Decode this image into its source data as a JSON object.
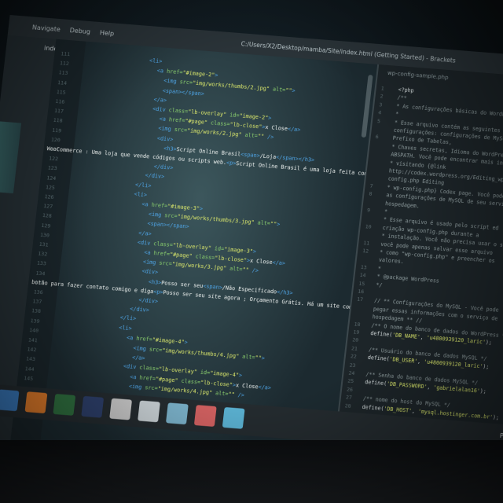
{
  "menubar": {
    "items": [
      "Navigate",
      "Debug",
      "Help"
    ],
    "window_title": "C:/Users/X2/Desktop/mamba/Site/index.html (Getting Started) - Brackets"
  },
  "sidebar": {
    "active_file": "index.html"
  },
  "editor": {
    "line_numbers": [
      "111",
      "112",
      "113",
      "114",
      "115",
      "116",
      "117",
      "118",
      "119",
      "120",
      "121",
      "122",
      "123",
      "124",
      "125",
      "126",
      "127",
      "128",
      "129",
      "130",
      "131",
      "132",
      "133",
      "134",
      "135",
      "136",
      "137",
      "138",
      "139",
      "140",
      "141",
      "142",
      "143",
      "144",
      "145"
    ],
    "lines": [
      {
        "indent": 110,
        "html": "<span class='tag'>&lt;li&gt;</span>"
      },
      {
        "indent": 126,
        "html": "<span class='tag'>&lt;a</span> <span class='attr'>href=</span><span class='str'>\"#image-2\"</span><span class='tag'>&gt;</span>"
      },
      {
        "indent": 140,
        "html": "<span class='tag'>&lt;img</span> <span class='attr'>src=</span><span class='str'>\"img/works/thumbs/2.jpg\"</span> <span class='attr'>alt=</span><span class='str'>\"\"</span><span class='tag'>&gt;</span>"
      },
      {
        "indent": 140,
        "html": "<span class='tag'>&lt;span&gt;&lt;/span&gt;</span>"
      },
      {
        "indent": 126,
        "html": "<span class='tag'>&lt;/a&gt;</span>"
      },
      {
        "indent": 126,
        "html": "<span class='tag'>&lt;div</span> <span class='attr'>class=</span><span class='str'>\"lb-overlay\"</span> <span class='attr'>id=</span><span class='str'>\"image-2\"</span><span class='tag'>&gt;</span>"
      },
      {
        "indent": 140,
        "html": "<span class='tag'>&lt;a</span> <span class='attr'>href=</span><span class='str'>\"#page\"</span> <span class='attr'>class=</span><span class='str'>\"lb-close\"</span><span class='tag'>&gt;</span><span class='txt'>x Close</span><span class='tag'>&lt;/a&gt;</span>"
      },
      {
        "indent": 140,
        "html": "<span class='tag'>&lt;img</span> <span class='attr'>src=</span><span class='str'>\"img/works/2.jpg\"</span> <span class='attr'>alt=</span><span class='str'>\"\"</span> <span class='tag'>/&gt;</span>"
      },
      {
        "indent": 140,
        "html": "<span class='tag'>&lt;div&gt;</span>"
      },
      {
        "indent": 154,
        "html": "<span class='tag'>&lt;h3&gt;</span><span class='txt'>Script Online Brasil</span><span class='tag'>&lt;span&gt;</span><span class='txt'>/Loja</span><span class='tag'>&lt;/span&gt;&lt;/h3&gt;</span>"
      },
      {
        "indent": 0,
        "html": "<span class='txt'>WooCommerce : Uma loja que vende códigos ou scripts web.</span><span class='tag'>&lt;p&gt;</span><span class='txt'>Script Online Brasil é uma loja feita com</span>"
      },
      {
        "indent": 140,
        "html": "<span class='tag'>&lt;/div&gt;</span>"
      },
      {
        "indent": 126,
        "html": "<span class='tag'>&lt;/div&gt;</span>"
      },
      {
        "indent": 110,
        "html": "<span class='tag'>&lt;/li&gt;</span>"
      },
      {
        "indent": 110,
        "html": "<span class='tag'>&lt;li&gt;</span>"
      },
      {
        "indent": 126,
        "html": "<span class='tag'>&lt;a</span> <span class='attr'>href=</span><span class='str'>\"#image-3\"</span><span class='tag'>&gt;</span>"
      },
      {
        "indent": 140,
        "html": "<span class='tag'>&lt;img</span> <span class='attr'>src=</span><span class='str'>\"img/works/thumbs/3.jpg\"</span> <span class='attr'>alt=</span><span class='str'>\"\"</span><span class='tag'>&gt;</span>"
      },
      {
        "indent": 140,
        "html": "<span class='tag'>&lt;span&gt;&lt;/span&gt;</span>"
      },
      {
        "indent": 126,
        "html": "<span class='tag'>&lt;/a&gt;</span>"
      },
      {
        "indent": 126,
        "html": "<span class='tag'>&lt;div</span> <span class='attr'>class=</span><span class='str'>\"lb-overlay\"</span> <span class='attr'>id=</span><span class='str'>\"image-3\"</span><span class='tag'>&gt;</span>"
      },
      {
        "indent": 140,
        "html": "<span class='tag'>&lt;a</span> <span class='attr'>href=</span><span class='str'>\"#page\"</span> <span class='attr'>class=</span><span class='str'>\"lb-close\"</span><span class='tag'>&gt;</span><span class='txt'>x Close</span><span class='tag'>&lt;/a&gt;</span>"
      },
      {
        "indent": 140,
        "html": "<span class='tag'>&lt;img</span> <span class='attr'>src=</span><span class='str'>\"img/works/3.jpg\"</span> <span class='attr'>alt=</span><span class='str'>\"\"</span> <span class='tag'>/&gt;</span>"
      },
      {
        "indent": 140,
        "html": "<span class='tag'>&lt;div&gt;</span>"
      },
      {
        "indent": 154,
        "html": "<span class='tag'>&lt;h3&gt;</span><span class='txt'>Posso ser seu</span><span class='tag'>&lt;span&gt;</span><span class='txt'>/Não Especificado</span><span class='tag'>&lt;/h3&gt;</span>"
      },
      {
        "indent": 0,
        "html": "<span class='txt'>botão para fazer contato comigo e diga</span><span class='tag'>&lt;p&gt;</span><span class='txt'>Posso ser seu site agora ; Orçamento Grátis. Há um site como quer seu site :)</span><span class='tag'>&lt;/p&gt;</span>"
      },
      {
        "indent": 140,
        "html": "<span class='tag'>&lt;/div&gt;</span>"
      },
      {
        "indent": 126,
        "html": "<span class='tag'>&lt;/div&gt;</span>"
      },
      {
        "indent": 110,
        "html": "<span class='tag'>&lt;/li&gt;</span>"
      },
      {
        "indent": 110,
        "html": "<span class='tag'>&lt;li&gt;</span>"
      },
      {
        "indent": 126,
        "html": "<span class='tag'>&lt;a</span> <span class='attr'>href=</span><span class='str'>\"#image-4\"</span><span class='tag'>&gt;</span>"
      },
      {
        "indent": 140,
        "html": "<span class='tag'>&lt;img</span> <span class='attr'>src=</span><span class='str'>\"img/works/thumbs/4.jpg\"</span> <span class='attr'>alt=</span><span class='str'>\"\"</span><span class='tag'>&gt;</span>"
      },
      {
        "indent": 140,
        "html": "<span class='tag'>&lt;/a&gt;</span>"
      },
      {
        "indent": 126,
        "html": "<span class='tag'>&lt;div</span> <span class='attr'>class=</span><span class='str'>\"lb-overlay\"</span> <span class='attr'>id=</span><span class='str'>\"image-4\"</span><span class='tag'>&gt;</span>"
      },
      {
        "indent": 140,
        "html": "<span class='tag'>&lt;a</span> <span class='attr'>href=</span><span class='str'>\"#page\"</span> <span class='attr'>class=</span><span class='str'>\"lb-close\"</span><span class='tag'>&gt;</span><span class='txt'>x Close</span><span class='tag'>&lt;/a&gt;</span>"
      },
      {
        "indent": 140,
        "html": "<span class='tag'>&lt;img</span> <span class='attr'>src=</span><span class='str'>\"img/works/4.jpg\"</span> <span class='attr'>alt=</span><span class='str'>\"\"</span> <span class='tag'>/&gt;</span>"
      }
    ]
  },
  "rightpane": {
    "tab": "wp-config-sample.php",
    "lines": [
      {
        "n": "1",
        "html": "<span class='fn'>&lt;?php</span>"
      },
      {
        "n": "2",
        "html": "<span class='cmt'>/**</span>"
      },
      {
        "n": "3",
        "html": "<span class='cmt'> * As configurações básicas do WordPress.</span>"
      },
      {
        "n": "4",
        "html": "<span class='cmt'> *</span>"
      },
      {
        "n": "5",
        "html": "<span class='cmt'> * Esse arquivo contém as seguintes</span>"
      },
      {
        "n": "",
        "html": "<span class='cmt'>configurações: configurações de MySQL,</span>"
      },
      {
        "n": "6",
        "html": "<span class='cmt'>Prefixo de Tabelas,</span>"
      },
      {
        "n": "",
        "html": "<span class='cmt'> * Chaves secretas, Idioma do WordPress, e</span>"
      },
      {
        "n": "",
        "html": "<span class='cmt'>ABSPATH. Você pode encontrar mais informações</span>"
      },
      {
        "n": "",
        "html": "<span class='cmt'> * visitando {@link</span>"
      },
      {
        "n": "",
        "html": "<span class='cmt'>http://codex.wordpress.org/Editing_wp-</span>"
      },
      {
        "n": "",
        "html": "<span class='cmt'>config.php Editing</span>"
      },
      {
        "n": "7",
        "html": "<span class='cmt'> * wp-config.php} Codex page. Você pode obter</span>"
      },
      {
        "n": "8",
        "html": "<span class='cmt'>as configurações de MySQL de seu servidor de</span>"
      },
      {
        "n": "",
        "html": "<span class='cmt'>hospedagem.</span>"
      },
      {
        "n": "9",
        "html": "<span class='cmt'> *</span>"
      },
      {
        "n": "",
        "html": "<span class='cmt'> * Esse arquivo é usado pelo script ed</span>"
      },
      {
        "n": "10",
        "html": "<span class='cmt'>criação wp-config.php durante a</span>"
      },
      {
        "n": "",
        "html": "<span class='cmt'> * instalação. Você não precisa usar o site,</span>"
      },
      {
        "n": "11",
        "html": "<span class='cmt'>você pode apenas salvar esse arquivo</span>"
      },
      {
        "n": "12",
        "html": "<span class='cmt'> * como \"wp-config.php\" e preencher os</span>"
      },
      {
        "n": "",
        "html": "<span class='cmt'>valores.</span>"
      },
      {
        "n": "13",
        "html": "<span class='cmt'> *</span>"
      },
      {
        "n": "14",
        "html": "<span class='cmt'> * @package WordPress</span>"
      },
      {
        "n": "15",
        "html": "<span class='cmt'> */</span>"
      },
      {
        "n": "16",
        "html": ""
      },
      {
        "n": "17",
        "html": "<span class='cmt'>// ** Configurações do MySQL - Você pode</span>"
      },
      {
        "n": "",
        "html": "<span class='cmt'>pegar essas informações com o serviço de</span>"
      },
      {
        "n": "",
        "html": "<span class='cmt'>hospedagem ** //</span>"
      },
      {
        "n": "18",
        "html": "<span class='cmt'>/** O nome do banco de dados do WordPress */</span>"
      },
      {
        "n": "19",
        "html": "<span class='fn'>define(</span><span class='s2'>'DB_NAME'</span><span class='fn'>, </span><span class='s2'>'u4800939120_laric'</span><span class='fn'>);</span>"
      },
      {
        "n": "20",
        "html": ""
      },
      {
        "n": "21",
        "html": "<span class='cmt'>/** Usuário do banco de dados MySQL */</span>"
      },
      {
        "n": "22",
        "html": "<span class='fn'>define(</span><span class='s2'>'DB_USER'</span><span class='fn'>, </span><span class='s2'>'u4800939120_laric'</span><span class='fn'>);</span>"
      },
      {
        "n": "23",
        "html": ""
      },
      {
        "n": "24",
        "html": "<span class='cmt'>/** Senha do banco de dados MySQL */</span>"
      },
      {
        "n": "25",
        "html": "<span class='fn'>define(</span><span class='s2'>'DB_PASSWORD'</span><span class='fn'>, </span><span class='s2'>'gabrielalan16'</span><span class='fn'>);</span>"
      },
      {
        "n": "26",
        "html": ""
      },
      {
        "n": "27",
        "html": "<span class='cmt'>/** nome do host do MySQL */</span>"
      },
      {
        "n": "28",
        "html": "<span class='fn'>define(</span><span class='s2'>'DB_HOST'</span><span class='fn'>, </span><span class='s2'>'mysql.hostinger.com.br'</span><span class='fn'>);</span>"
      }
    ]
  },
  "taskbar": {
    "icons": [
      {
        "name": "start-icon",
        "color": "#3a7bbf"
      },
      {
        "name": "browser-icon",
        "color": "#e07b2a"
      },
      {
        "name": "app-icon",
        "color": "#2f6f3f"
      },
      {
        "name": "photoshop-icon",
        "color": "#2d3f6a"
      },
      {
        "name": "app2-icon",
        "color": "#c8c8c8"
      },
      {
        "name": "app3-icon",
        "color": "#c8d0d4"
      },
      {
        "name": "app4-icon",
        "color": "#7ab0c8"
      },
      {
        "name": "app5-icon",
        "color": "#d06060"
      },
      {
        "name": "app6-icon",
        "color": "#5ab0d0"
      }
    ],
    "tray_text": "PT"
  }
}
